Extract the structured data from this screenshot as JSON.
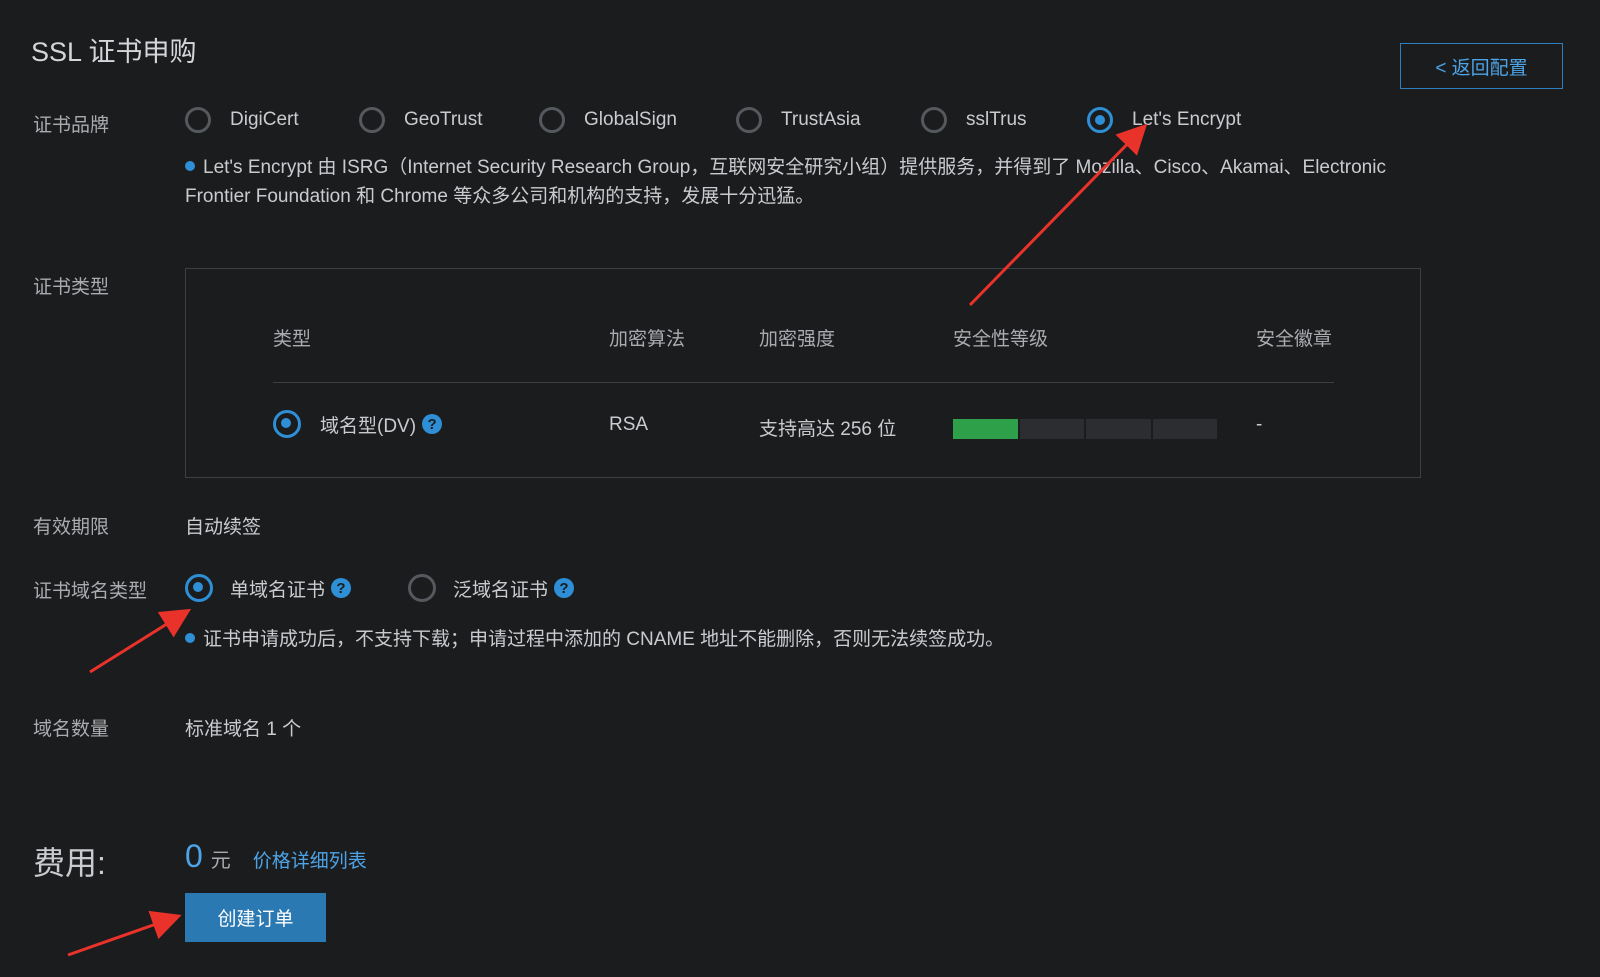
{
  "page_title": "SSL 证书申购",
  "back_button": {
    "icon": "chevron-left-icon",
    "label": "< 返回配置"
  },
  "brand": {
    "label": "证书品牌",
    "options": [
      "DigiCert",
      "GeoTrust",
      "GlobalSign",
      "TrustAsia",
      "sslTrus",
      "Let's Encrypt"
    ],
    "selected": "Let's Encrypt",
    "note_line1": "Let's Encrypt 由 ISRG（Internet Security Research Group，互联网安全研究小组）提供服务，并得到了 Mozilla、Cisco、Akamai、Electronic",
    "note_line2": "Frontier Foundation 和 Chrome 等众多公司和机构的支持，发展十分迅猛。"
  },
  "cert_type": {
    "label": "证书类型",
    "headers": {
      "type": "类型",
      "algorithm": "加密算法",
      "strength": "加密强度",
      "security_level": "安全性等级",
      "seal": "安全徽章"
    },
    "row": {
      "type": "域名型(DV)",
      "algorithm": "RSA",
      "strength": "支持高达 256 位",
      "security_level_segments_filled": 1,
      "security_level_segments_total": 4,
      "seal": "-"
    }
  },
  "validity": {
    "label": "有效期限",
    "value": "自动续签"
  },
  "domain_type": {
    "label": "证书域名类型",
    "options": [
      "单域名证书",
      "泛域名证书"
    ],
    "selected": "单域名证书",
    "note": "证书申请成功后，不支持下载；申请过程中添加的 CNAME 地址不能删除，否则无法续签成功。"
  },
  "domain_count": {
    "label": "域名数量",
    "value": "标准域名 1 个"
  },
  "fee": {
    "label": "费用:",
    "amount": "0",
    "unit": "元",
    "price_link": "价格详细列表"
  },
  "create_button": {
    "label": "创建订单"
  },
  "colors": {
    "background": "#1b1c1e",
    "accent": "#2e8fd6",
    "button": "#2b79b3",
    "bar_on": "#2ea04a",
    "annotation_arrow": "#e8322a"
  }
}
